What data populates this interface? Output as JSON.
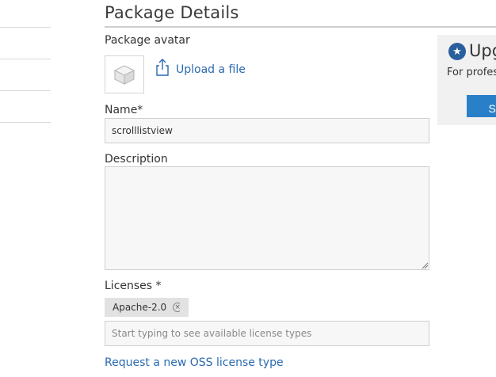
{
  "page": {
    "title": "Package Details"
  },
  "avatar": {
    "label": "Package avatar",
    "upload_label": "Upload a file"
  },
  "name_field": {
    "label": "Name*",
    "value": "scrolllistview"
  },
  "description_field": {
    "label": "Description",
    "value": ""
  },
  "licenses": {
    "label": "Licenses *",
    "tags": [
      "Apache-2.0"
    ],
    "input_placeholder": "Start typing to see available license types",
    "request_link": "Request a new OSS license type"
  },
  "upgrade_panel": {
    "title": "Upg",
    "subtitle": "For profes",
    "button_label": "Sta"
  },
  "icons": {
    "avatar": "package-box-icon",
    "upload": "upload-icon",
    "tag_remove": "close-circle-icon",
    "upgrade": "star-icon"
  }
}
